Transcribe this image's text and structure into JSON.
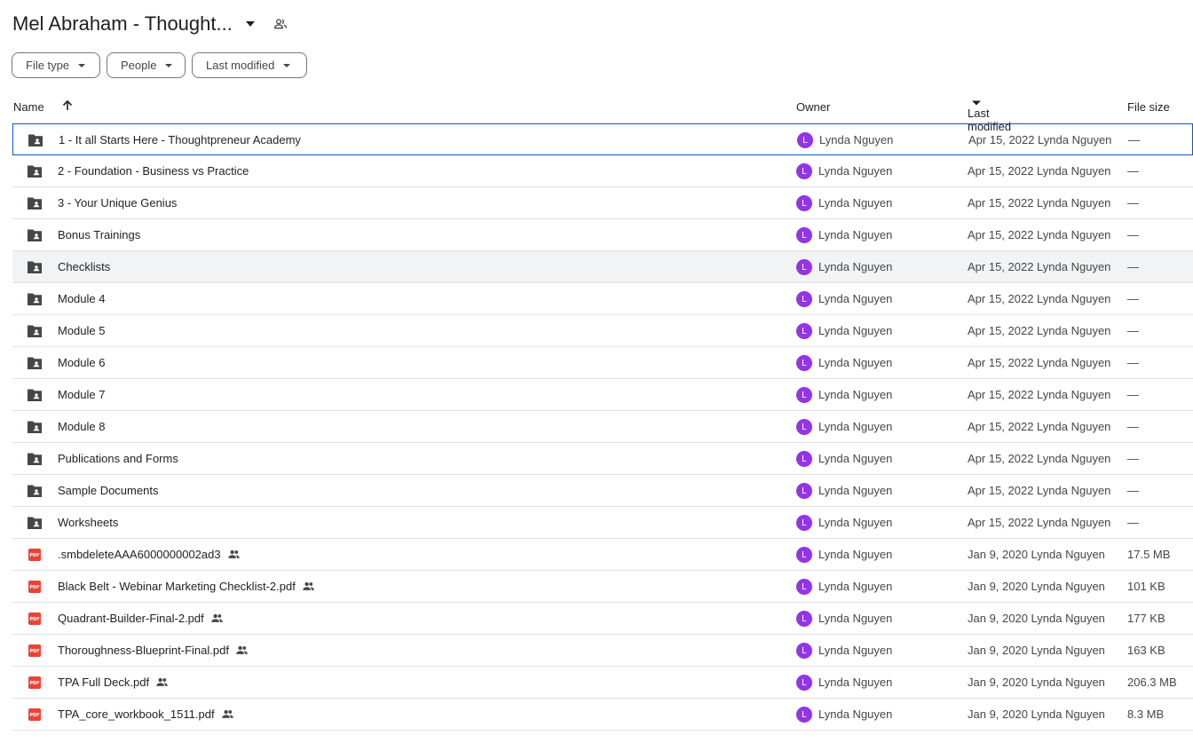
{
  "header": {
    "title": "Mel Abraham - Thought...",
    "caret_icon": "arrow-drop-down-icon",
    "share_icon": "shared-people-icon"
  },
  "filters": [
    {
      "label": "File type"
    },
    {
      "label": "People"
    },
    {
      "label": "Last modified"
    }
  ],
  "columns": {
    "name": "Name",
    "owner": "Owner",
    "last_modified": "Last modified",
    "file_size": "File size"
  },
  "colors": {
    "avatar": "#9334e6",
    "pdf": "#ea4335",
    "folder": "#444746",
    "selected_border": "#0b57d0"
  },
  "rows": [
    {
      "type": "folder",
      "name": "1 - It all Starts Here - Thoughtpreneur Academy",
      "avatar": "L",
      "owner": "Lynda Nguyen",
      "modified": "Apr 15, 2022 Lynda Nguyen",
      "size": "—",
      "shared": false
    },
    {
      "type": "folder",
      "name": "2 - Foundation - Business vs Practice",
      "avatar": "L",
      "owner": "Lynda Nguyen",
      "modified": "Apr 15, 2022 Lynda Nguyen",
      "size": "—",
      "shared": false
    },
    {
      "type": "folder",
      "name": "3 - Your Unique Genius",
      "avatar": "L",
      "owner": "Lynda Nguyen",
      "modified": "Apr 15, 2022 Lynda Nguyen",
      "size": "—",
      "shared": false
    },
    {
      "type": "folder",
      "name": "Bonus Trainings",
      "avatar": "L",
      "owner": "Lynda Nguyen",
      "modified": "Apr 15, 2022 Lynda Nguyen",
      "size": "—",
      "shared": false
    },
    {
      "type": "folder",
      "name": "Checklists",
      "avatar": "L",
      "owner": "Lynda Nguyen",
      "modified": "Apr 15, 2022 Lynda Nguyen",
      "size": "—",
      "shared": false
    },
    {
      "type": "folder",
      "name": "Module 4",
      "avatar": "L",
      "owner": "Lynda Nguyen",
      "modified": "Apr 15, 2022 Lynda Nguyen",
      "size": "—",
      "shared": false
    },
    {
      "type": "folder",
      "name": "Module 5",
      "avatar": "L",
      "owner": "Lynda Nguyen",
      "modified": "Apr 15, 2022 Lynda Nguyen",
      "size": "—",
      "shared": false
    },
    {
      "type": "folder",
      "name": "Module 6",
      "avatar": "L",
      "owner": "Lynda Nguyen",
      "modified": "Apr 15, 2022 Lynda Nguyen",
      "size": "—",
      "shared": false
    },
    {
      "type": "folder",
      "name": "Module 7",
      "avatar": "L",
      "owner": "Lynda Nguyen",
      "modified": "Apr 15, 2022 Lynda Nguyen",
      "size": "—",
      "shared": false
    },
    {
      "type": "folder",
      "name": "Module 8",
      "avatar": "L",
      "owner": "Lynda Nguyen",
      "modified": "Apr 15, 2022 Lynda Nguyen",
      "size": "—",
      "shared": false
    },
    {
      "type": "folder",
      "name": "Publications and Forms",
      "avatar": "L",
      "owner": "Lynda Nguyen",
      "modified": "Apr 15, 2022 Lynda Nguyen",
      "size": "—",
      "shared": false
    },
    {
      "type": "folder",
      "name": "Sample Documents",
      "avatar": "L",
      "owner": "Lynda Nguyen",
      "modified": "Apr 15, 2022 Lynda Nguyen",
      "size": "—",
      "shared": false
    },
    {
      "type": "folder",
      "name": "Worksheets",
      "avatar": "L",
      "owner": "Lynda Nguyen",
      "modified": "Apr 15, 2022 Lynda Nguyen",
      "size": "—",
      "shared": false
    },
    {
      "type": "pdf",
      "name": ".smbdeleteAAA6000000002ad3",
      "avatar": "L",
      "owner": "Lynda Nguyen",
      "modified": "Jan 9, 2020 Lynda Nguyen",
      "size": "17.5 MB",
      "shared": true
    },
    {
      "type": "pdf",
      "name": "Black Belt - Webinar Marketing Checklist-2.pdf",
      "avatar": "L",
      "owner": "Lynda Nguyen",
      "modified": "Jan 9, 2020 Lynda Nguyen",
      "size": "101 KB",
      "shared": true
    },
    {
      "type": "pdf",
      "name": "Quadrant-Builder-Final-2.pdf",
      "avatar": "L",
      "owner": "Lynda Nguyen",
      "modified": "Jan 9, 2020 Lynda Nguyen",
      "size": "177 KB",
      "shared": true
    },
    {
      "type": "pdf",
      "name": "Thoroughness-Blueprint-Final.pdf",
      "avatar": "L",
      "owner": "Lynda Nguyen",
      "modified": "Jan 9, 2020 Lynda Nguyen",
      "size": "163 KB",
      "shared": true
    },
    {
      "type": "pdf",
      "name": "TPA Full Deck.pdf",
      "avatar": "L",
      "owner": "Lynda Nguyen",
      "modified": "Jan 9, 2020 Lynda Nguyen",
      "size": "206.3 MB",
      "shared": true
    },
    {
      "type": "pdf",
      "name": "TPA_core_workbook_1511.pdf",
      "avatar": "L",
      "owner": "Lynda Nguyen",
      "modified": "Jan 9, 2020 Lynda Nguyen",
      "size": "8.3 MB",
      "shared": true
    }
  ]
}
